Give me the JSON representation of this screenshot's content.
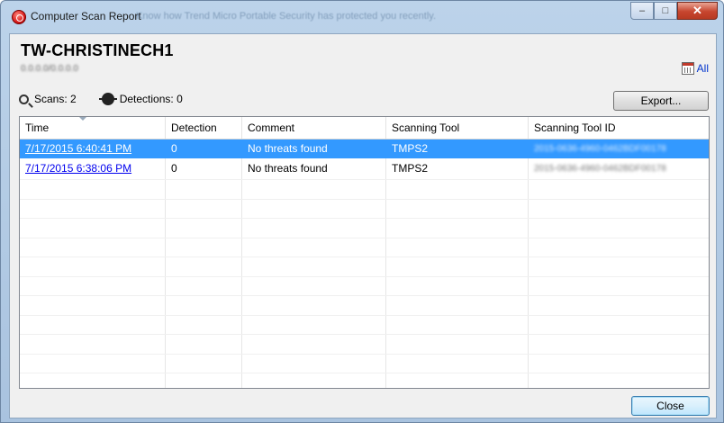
{
  "window": {
    "title": "Computer Scan Report",
    "title_ghost": "Know how Trend Micro Portable Security has protected you recently.",
    "minimize_label": "‒",
    "maximize_label": "□",
    "close_label": "✕"
  },
  "header": {
    "hostname": "TW-CHRISTINECH1",
    "subtitle": "0.0.0.0/0.0.0.0",
    "all_label": "All"
  },
  "stats": {
    "scans_label": "Scans: 2",
    "detections_label": "Detections: 0"
  },
  "toolbar": {
    "export_label": "Export..."
  },
  "table": {
    "columns": [
      "Time",
      "Detection",
      "Comment",
      "Scanning Tool",
      "Scanning Tool ID"
    ],
    "rows": [
      {
        "time": "7/17/2015 6:40:41 PM",
        "detection": "0",
        "comment": "No threats found",
        "tool": "TMPS2",
        "tool_id": "2015-0636-4960-0462BDF00178",
        "selected": true
      },
      {
        "time": "7/17/2015 6:38:06 PM",
        "detection": "0",
        "comment": "No threats found",
        "tool": "TMPS2",
        "tool_id": "2015-0636-4960-0462BDF00178",
        "selected": false
      }
    ]
  },
  "footer": {
    "close_label": "Close"
  },
  "colors": {
    "selection": "#3399ff",
    "link": "#0000ee",
    "all_link": "#0033cc"
  },
  "icons": [
    "app-logo-icon",
    "calendar-icon",
    "magnifier-icon",
    "bug-icon"
  ]
}
